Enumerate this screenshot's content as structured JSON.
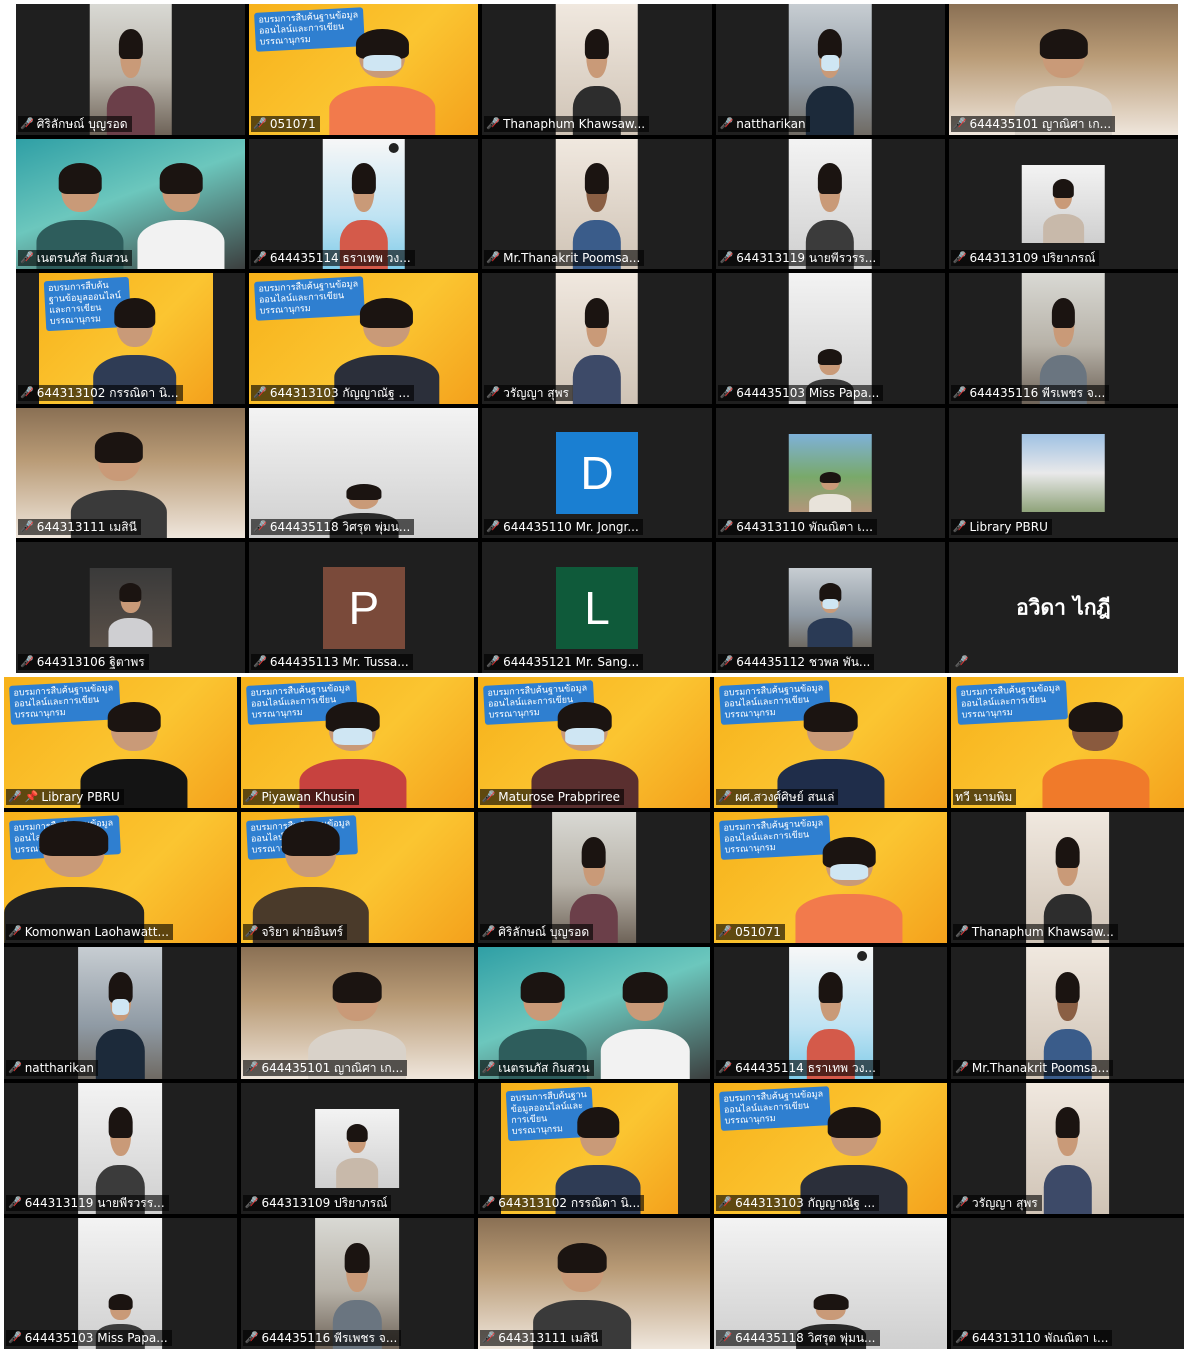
{
  "colors": {
    "gallery_background": "#000000",
    "tile_background": "#1f1f1f",
    "muted_icon": "#ff2d2d",
    "active_speaker_border": "#e6ec5b",
    "avatar_D": "#1a7fd2",
    "avatar_P": "#7a4a3a",
    "avatar_L": "#0f5a3a",
    "poster_yellow": "#fbc531"
  },
  "icons": {
    "muted": "microphone-muted-icon",
    "pinned": "pin-icon"
  },
  "gallery1": {
    "participants": [
      {
        "name": "ศิริลักษณ์ บุญรอด"
      },
      {
        "name": "051071"
      },
      {
        "name": "Thanaphum Khawsaw..."
      },
      {
        "name": "nattharikan"
      },
      {
        "name": "644435101 ญาณิศา เก..."
      },
      {
        "name": "เนตรนภัส กิมสวน"
      },
      {
        "name": "644435114 ธราเทพ วง..."
      },
      {
        "name": "Mr.Thanakrit Poomsa..."
      },
      {
        "name": "644313119 นายพีรวรร..."
      },
      {
        "name": "644313109 ปริยาภรณ์"
      },
      {
        "name": "644313102 กรรณิดา นิ..."
      },
      {
        "name": "644313103 กัญญาณัฐ ..."
      },
      {
        "name": "วรัญญา สุพร"
      },
      {
        "name": "644435103 Miss Papa..."
      },
      {
        "name": "644435116 พีรเพชร จ..."
      },
      {
        "name": "644313111 เมสินี"
      },
      {
        "name": "644435118 วิศรุต พุ่มน..."
      },
      {
        "name": "644435110 Mr. Jongr...",
        "avatar_letter": "D"
      },
      {
        "name": "644313110 พัณณิตา เ..."
      },
      {
        "name": "Library PBRU"
      },
      {
        "name": "644313106 ฐิตาพร"
      },
      {
        "name": "644435113 Mr. Tussa...",
        "avatar_letter": "P"
      },
      {
        "name": "644435121 Mr. Sang...",
        "avatar_letter": "L"
      },
      {
        "name": "644435112 ชวพล พัน..."
      },
      {
        "name": "",
        "name_card": "อวิดา ไกฎี"
      }
    ]
  },
  "gallery2": {
    "participants": [
      {
        "name": "Library PBRU"
      },
      {
        "name": "Piyawan Khusin"
      },
      {
        "name": "Maturose Prabpriree"
      },
      {
        "name": "ผศ.สวงศ์ศิษย์ สนเล่"
      },
      {
        "name": "ทวี นามพิม"
      },
      {
        "name": "Komonwan Laohawatt..."
      },
      {
        "name": "จริยา ผ่ายอินทร์"
      },
      {
        "name": "ศิริลักษณ์ บุญรอด"
      },
      {
        "name": "051071"
      },
      {
        "name": "Thanaphum Khawsaw..."
      },
      {
        "name": "nattharikan"
      },
      {
        "name": "644435101 ญาณิศา เก..."
      },
      {
        "name": "เนตรนภัส กิมสวน"
      },
      {
        "name": "644435114 ธราเทพ วง..."
      },
      {
        "name": "Mr.Thanakrit Poomsa..."
      },
      {
        "name": "644313119 นายพีรวรร..."
      },
      {
        "name": "644313109 ปริยาภรณ์"
      },
      {
        "name": "644313102 กรรณิดา นิ..."
      },
      {
        "name": "644313103 กัญญาณัฐ ..."
      },
      {
        "name": "วรัญญา สุพร"
      },
      {
        "name": "644435103 Miss Papa..."
      },
      {
        "name": "644435116 พีรเพชร จ..."
      },
      {
        "name": "644313111 เมสินี"
      },
      {
        "name": "644435118 วิศรุต พุ่มน..."
      },
      {
        "name": "644313110 พัณณิตา เ..."
      }
    ]
  },
  "poster_text": "อบรมการสืบค้นฐานข้อมูลออนไลน์และการเขียนบรรณานุกรม"
}
